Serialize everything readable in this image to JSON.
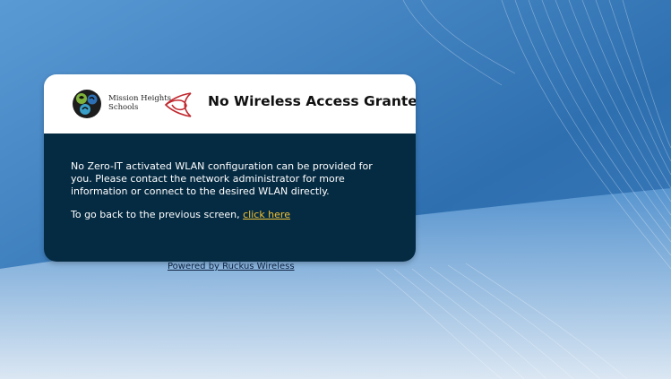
{
  "header": {
    "logo_line1": "Mission Heights",
    "logo_line2": "Schools",
    "title": "No Wireless Access Granted"
  },
  "message": {
    "text": "No Zero-IT activated WLAN configuration can be provided for you. Please contact the network administrator for more information or connect to the desired WLAN directly.",
    "back_prefix": "To go back to the previous screen, ",
    "back_link": "click here"
  },
  "footer": {
    "powered_by": "Powered by Ruckus Wireless"
  },
  "colors": {
    "card_body": "#052b43",
    "link": "#f2c230",
    "knot": "#c0272d"
  }
}
